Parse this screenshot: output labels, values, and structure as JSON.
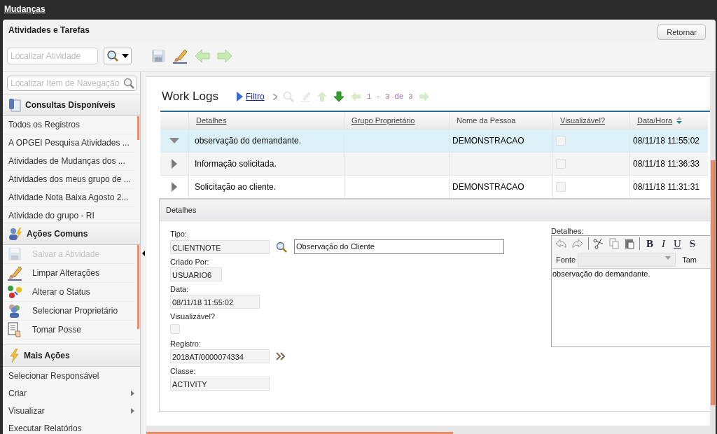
{
  "app_bar": {
    "title": "Mudanças"
  },
  "header": {
    "title": "Atividades e Tarefas",
    "back_button": "Retornar"
  },
  "toolbar": {
    "search": {
      "placeholder": "Localizar Atividade"
    }
  },
  "sidebar": {
    "search": {
      "placeholder": "Localizar Item de Navegação"
    },
    "sections": [
      {
        "title": "Consultas Disponíveis",
        "kind": "queries",
        "items": [
          {
            "label": "Todos os Registros"
          },
          {
            "label": "A OPGEI Pesquisa Atividades ..."
          },
          {
            "label": "Atividades de Mudanças dos ..."
          },
          {
            "label": "Atividades dos meus grupo de ..."
          },
          {
            "label": "Atividade Nota Baixa Agosto 2..."
          },
          {
            "label": "Atividade do grupo - RI"
          }
        ]
      },
      {
        "title": "Ações Comuns",
        "kind": "actions",
        "items": [
          {
            "label": "Salvar a Atividade",
            "disabled": true
          },
          {
            "label": "Limpar Alterações",
            "disabled": false
          },
          {
            "label": "Alterar o Status",
            "disabled": false
          },
          {
            "label": "Selecionar Proprietário",
            "disabled": false
          },
          {
            "label": "Tomar Posse",
            "disabled": false
          }
        ]
      },
      {
        "title": "Mais Ações",
        "kind": "more",
        "items": [
          {
            "label": "Selecionar Responsável",
            "submenu": false
          },
          {
            "label": "Criar",
            "submenu": true
          },
          {
            "label": "Visualizar",
            "submenu": true
          },
          {
            "label": "Executar Relatórios",
            "submenu": false
          }
        ]
      }
    ]
  },
  "work_logs": {
    "title": "Work Logs",
    "filter_link": "Filtro",
    "pager": "1 - 3 de 3",
    "columns": [
      {
        "label": "Detalhes",
        "sortable": true
      },
      {
        "label": "Grupo Proprietário",
        "sortable": true
      },
      {
        "label": "Nome da Pessoa",
        "sortable": false
      },
      {
        "label": "Visualizável?",
        "sortable": true
      },
      {
        "label": "Data/Hora",
        "sortable": true
      }
    ],
    "rows": [
      {
        "expanded": true,
        "selected": true,
        "details": "observação do demandante.",
        "person": "DEMONSTRACAO",
        "visible": false,
        "date": "08/11/18 11:55:02"
      },
      {
        "expanded": false,
        "selected": false,
        "details": "Informação solicitada.",
        "visible": false,
        "date": "08/11/18 11:36:33"
      },
      {
        "expanded": false,
        "selected": false,
        "details": "Solicitação ao cliente.",
        "person": "DEMONSTRACAO",
        "visible": false,
        "date": "08/11/18 11:31:31"
      }
    ]
  },
  "details": {
    "title": "Detalhes",
    "fields": [
      {
        "label": "Tipo:",
        "kind": "lookup",
        "value": "CLIENTNOTE",
        "description": "Observação do Cliente"
      },
      {
        "label": "Criado Por:",
        "kind": "text",
        "value": "USUARIO6"
      },
      {
        "label": "Data:",
        "kind": "text",
        "value": "08/11/18 11:55:02"
      },
      {
        "label": "Visualizável?",
        "kind": "checkbox",
        "checked": false
      },
      {
        "label": "Registro:",
        "kind": "link",
        "value": "2018AT/0000074334"
      },
      {
        "label": "Classe:",
        "kind": "text",
        "value": "ACTIVITY"
      }
    ],
    "editor": {
      "label": "Detalhes:",
      "format_buttons": [
        "B",
        "I",
        "U",
        "S"
      ],
      "font_label": "Fonte",
      "size_label": "Tam",
      "content": "observação do demandante."
    }
  }
}
